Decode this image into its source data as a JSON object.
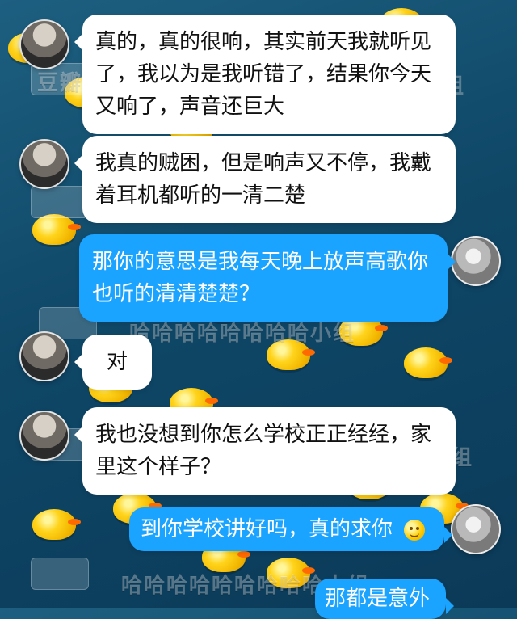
{
  "watermark": {
    "logo_text": "豆瓣",
    "group_text_1": "小组",
    "group_text_2": "哈哈哈哈哈哈哈哈小组",
    "group_text_3": "小组",
    "group_text_4": "哈哈哈哈哈哈哈哈哈小组"
  },
  "messages": [
    {
      "side": "left",
      "text": "真的，真的很响，其实前天我就听见了，我以为是我听错了，结果你今天又响了，声音还巨大"
    },
    {
      "side": "left",
      "text": "我真的贼困，但是响声又不停，我戴着耳机都听的一清二楚"
    },
    {
      "side": "right",
      "text": "那你的意思是我每天晚上放声高歌你也听的清清楚楚？"
    },
    {
      "side": "left",
      "text": "对"
    },
    {
      "side": "left",
      "text": "我也没想到你怎么学校正正经经，家里这个样子？"
    },
    {
      "side": "right",
      "text": "到你学校讲好吗，真的求你"
    },
    {
      "side": "right",
      "text": "那都是意外"
    }
  ],
  "colors": {
    "bubble_white": "#ffffff",
    "bubble_blue": "#1aa3ff",
    "water_dark": "#0b3a58"
  }
}
